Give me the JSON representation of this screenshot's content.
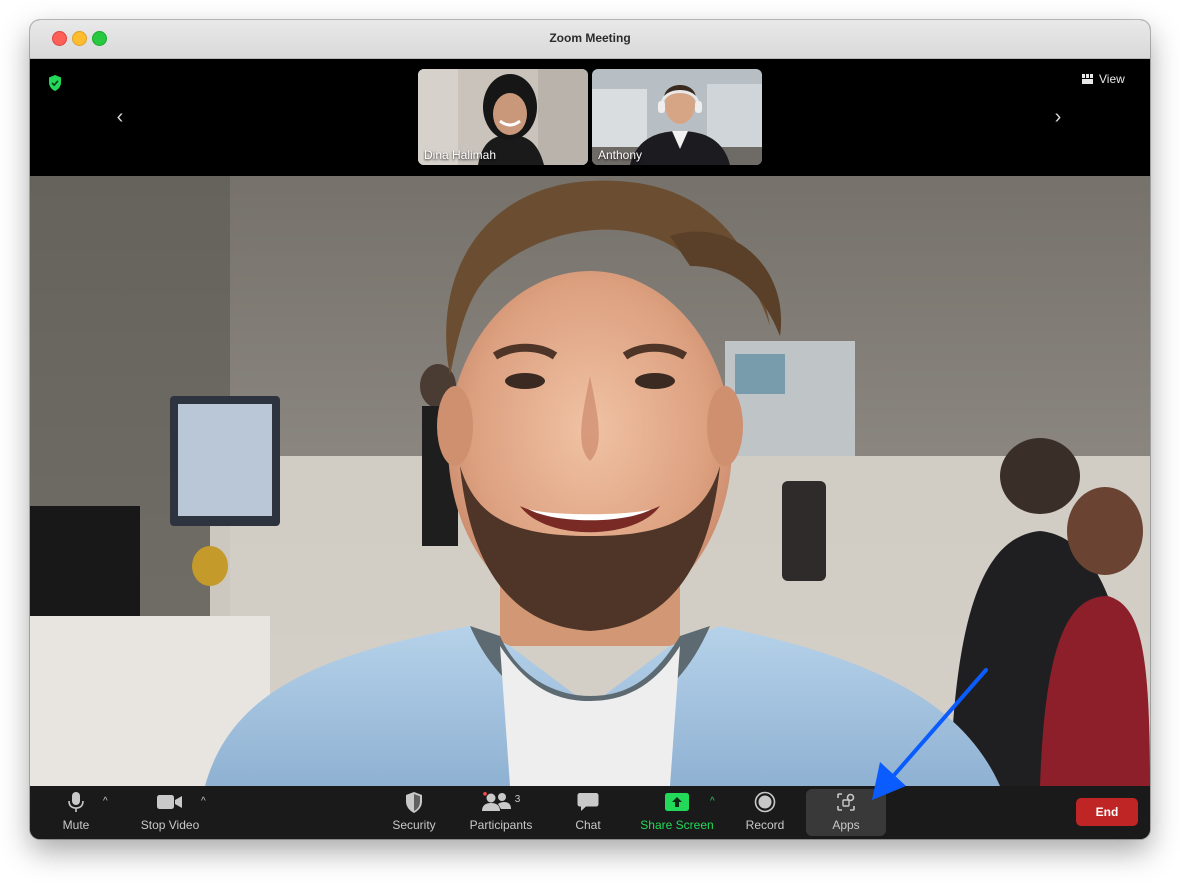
{
  "window": {
    "title": "Zoom Meeting"
  },
  "top_bar": {
    "view_label": "View",
    "participants": [
      {
        "name": "Dina Halimah"
      },
      {
        "name": "Anthony"
      }
    ]
  },
  "toolbar": {
    "mute_label": "Mute",
    "stop_video_label": "Stop Video",
    "security_label": "Security",
    "participants_label": "Participants",
    "participants_count": "3",
    "chat_label": "Chat",
    "share_screen_label": "Share Screen",
    "record_label": "Record",
    "apps_label": "Apps",
    "end_label": "End"
  },
  "colors": {
    "share_green": "#23d959",
    "end_red": "#c02525",
    "annotation_arrow": "#0a5cff",
    "security_shield": "#23d959"
  },
  "icons": [
    "shield-check-icon",
    "chevron-left-icon",
    "chevron-right-icon",
    "grid-icon",
    "microphone-icon",
    "video-camera-icon",
    "security-shield-icon",
    "participants-icon",
    "chat-bubble-icon",
    "share-screen-icon",
    "record-icon",
    "apps-icon",
    "caret-up-icon"
  ]
}
